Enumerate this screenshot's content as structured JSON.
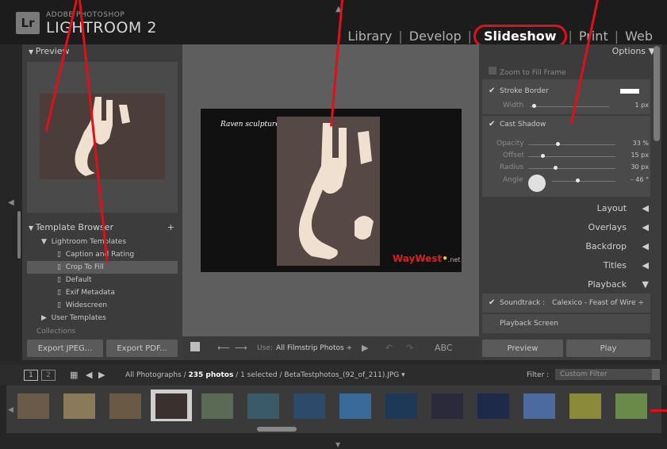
{
  "header": {
    "badge": "Lr",
    "brand_small": "ADOBE PHOTOSHOP",
    "brand_big": "LIGHTROOM 2",
    "modules": [
      "Library",
      "Develop",
      "Slideshow",
      "Print",
      "Web"
    ],
    "active_module": "Slideshow"
  },
  "left_panel": {
    "preview_label": "Preview",
    "template_browser_label": "Template Browser",
    "template_items": [
      {
        "label": "Lightroom Templates",
        "group": true
      },
      {
        "label": "Caption and Rating",
        "group": false
      },
      {
        "label": "Crop To Fill",
        "group": false,
        "selected": true
      },
      {
        "label": "Default",
        "group": false
      },
      {
        "label": "Exif Metadata",
        "group": false
      },
      {
        "label": "Widescreen",
        "group": false
      },
      {
        "label": "User Templates",
        "group": true
      }
    ],
    "collections_label": "Collections",
    "export_jpeg_label": "Export JPEG...",
    "export_pdf_label": "Export PDF..."
  },
  "center": {
    "caption": "Raven sculpture",
    "watermark": "WayWest",
    "watermark_suffix": ".net",
    "toolbar_use_label": "Use:",
    "toolbar_use_value": "All Filmstrip Photos",
    "toolbar_abc": "ABC"
  },
  "right_panel": {
    "options_label": "Options",
    "zoom_to_fill_label": "Zoom to Fill Frame",
    "stroke_border_label": "Stroke Border",
    "width_label": "Width",
    "width_value": "1 px",
    "cast_shadow_label": "Cast Shadow",
    "shadow_sliders": [
      {
        "label": "Opacity",
        "value": "33 %",
        "fraction": 0.33
      },
      {
        "label": "Offset",
        "value": "15 px",
        "fraction": 0.15
      },
      {
        "label": "Radius",
        "value": "30 px",
        "fraction": 0.3
      },
      {
        "label": "Angle",
        "value": "– 46 °",
        "fraction": 0.4
      }
    ],
    "sections": [
      "Layout",
      "Overlays",
      "Backdrop",
      "Titles",
      "Playback"
    ],
    "soundtrack_label": "Soundtrack :",
    "soundtrack_value": "Calexico - Feast of Wire",
    "playback_screen_label": "Playback Screen",
    "preview_button": "Preview",
    "play_button": "Play"
  },
  "filmstrip_bar": {
    "page1": "1",
    "page2": "2",
    "path_prefix": "All Photographs /",
    "photo_count": "235 photos",
    "path_suffix": "/ 1 selected / BetaTestphotos_(92_of_211).JPG",
    "filter_label": "Filter :",
    "filter_value": "Custom Filter"
  },
  "filmstrip": {
    "thumb_colors": [
      "#6a5a4a",
      "#8a7a5a",
      "#6a5a45",
      "#3a3030",
      "#5a6a55",
      "#3a5a6a",
      "#2c4a6a",
      "#3a6a9a",
      "#1e3858",
      "#2a2a3a",
      "#1e2a4a",
      "#4a6aa0",
      "#8a8a3a",
      "#6a8a4a"
    ],
    "selected_index": 3
  },
  "colors": {
    "annotation_red": "#e0101a"
  }
}
